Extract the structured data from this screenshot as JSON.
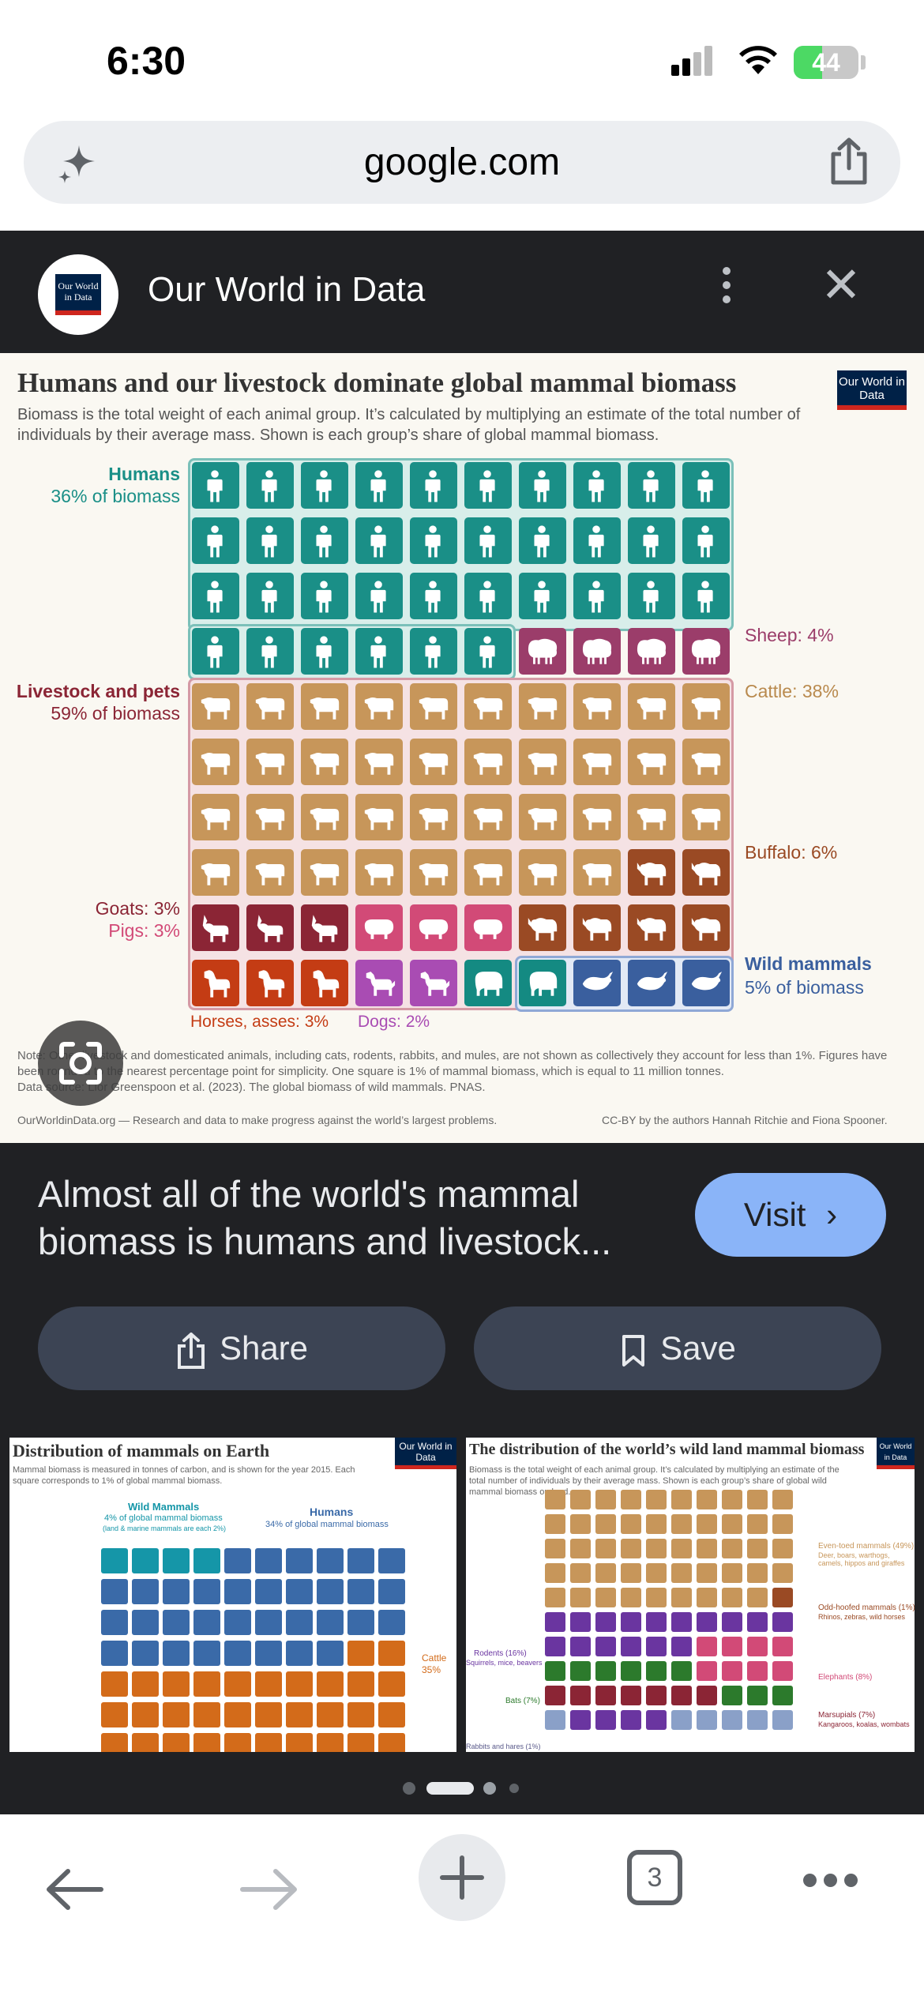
{
  "status": {
    "time": "6:30",
    "battery": "44",
    "battery_level": 0.44
  },
  "browser": {
    "url": "google.com"
  },
  "source": {
    "name": "Our World in Data",
    "logo_text": "Our World in Data"
  },
  "infographic": {
    "title": "Humans and our livestock dominate global mammal biomass",
    "subtitle": "Biomass is the total weight of each animal group. It’s calculated by multiplying an estimate of the total number of individuals by their average mass. Shown is each group’s share of global mammal biomass.",
    "logo": "Our World in Data",
    "labels": {
      "humans": "Humans",
      "humans_share": "36% of biomass",
      "livestock": "Livestock and pets",
      "livestock_share": "59% of biomass",
      "sheep": "Sheep: 4%",
      "cattle": "Cattle: 38%",
      "buffalo": "Buffalo: 6%",
      "goats": "Goats: 3%",
      "pigs": "Pigs: 3%",
      "wild": "Wild mammals",
      "wild_share": "5% of biomass",
      "horses": "Horses, asses: 3%",
      "dogs": "Dogs: 2%"
    },
    "colors": {
      "humans": "#1a8f87",
      "sheep": "#9b3d6a",
      "cattle": "#c7965a",
      "buffalo": "#9a4a24",
      "goats": "#8b2535",
      "pigs": "#d24a77",
      "horses": "#c43c14",
      "dogs": "#a94cb3",
      "elephants": "#148a82",
      "whales": "#3a5f9e"
    },
    "note": "Note: Other livestock and domesticated animals, including cats, rodents, rabbits, and mules, are not shown as collectively they account for less than 1%. Figures have been rounded to the nearest percentage point for simplicity. One square is 1% of mammal biomass, which is equal to 11 million tonnes.",
    "data_source": "Data source: Lior Greenspoon et al. (2023). The global biomass of wild mammals. PNAS.",
    "footer_left": "OurWorldinData.org — Research and data to make progress against the world’s largest problems.",
    "footer_right": "CC-BY by the authors Hannah Ritchie and Fiona Spooner."
  },
  "chart_data": {
    "type": "table",
    "title": "Humans and our livestock dominate global mammal biomass",
    "series": [
      {
        "name": "Humans",
        "values": [
          36
        ]
      },
      {
        "name": "Sheep",
        "values": [
          4
        ]
      },
      {
        "name": "Cattle",
        "values": [
          38
        ]
      },
      {
        "name": "Buffalo",
        "values": [
          6
        ]
      },
      {
        "name": "Goats",
        "values": [
          3
        ]
      },
      {
        "name": "Pigs",
        "values": [
          3
        ]
      },
      {
        "name": "Horses, asses",
        "values": [
          3
        ]
      },
      {
        "name": "Dogs",
        "values": [
          2
        ]
      },
      {
        "name": "Wild mammals",
        "values": [
          5
        ]
      }
    ]
  },
  "result": {
    "title": "Almost all of the world's mammal biomass is humans and livestock...",
    "visit": "Visit",
    "share": "Share",
    "save": "Save"
  },
  "related": [
    {
      "title": "Distribution of mammals on Earth",
      "subtitle": "Mammal biomass is measured in tonnes of carbon, and is shown for the year 2015. Each square corresponds to 1% of global mammal biomass.",
      "logo": "Our World in Data",
      "labels": {
        "wild": "Wild Mammals",
        "wild_share": "4% of global mammal biomass",
        "wild_note": "(land & marine mammals are each 2%)",
        "humans": "Humans",
        "humans_share": "34% of global mammal biomass",
        "cattle": "Cattle",
        "cattle_share": "35%"
      }
    },
    {
      "title": "The distribution of the world’s wild land mammal biomass",
      "subtitle": "Biomass is the total weight of each animal group. It’s calculated by multiplying an estimate of the total number of individuals by their average mass. Shown is each group’s share of global wild mammal biomass on land.",
      "logo": "Our World in Data",
      "labels": {
        "even_toed": "Even-toed mammals (49%)",
        "even_toed_note": "Deer, boars, warthogs, camels, hippos and giraffes",
        "odd_toed": "Odd-hoofed mammals (1%)",
        "odd_toed_note": "Rhinos, zebras, wild horses",
        "rodents": "Rodents (16%)",
        "rodents_note": "Squirrels, mice, beavers",
        "elephants": "Elephants (8%)",
        "bats": "Bats (7%)",
        "marsupials": "Marsupials (7%)",
        "marsupials_note": "Kangaroos, koalas, wombats",
        "rabbits": "Rabbits and hares (1%)"
      }
    }
  ],
  "toolbar": {
    "tabs": "3"
  }
}
